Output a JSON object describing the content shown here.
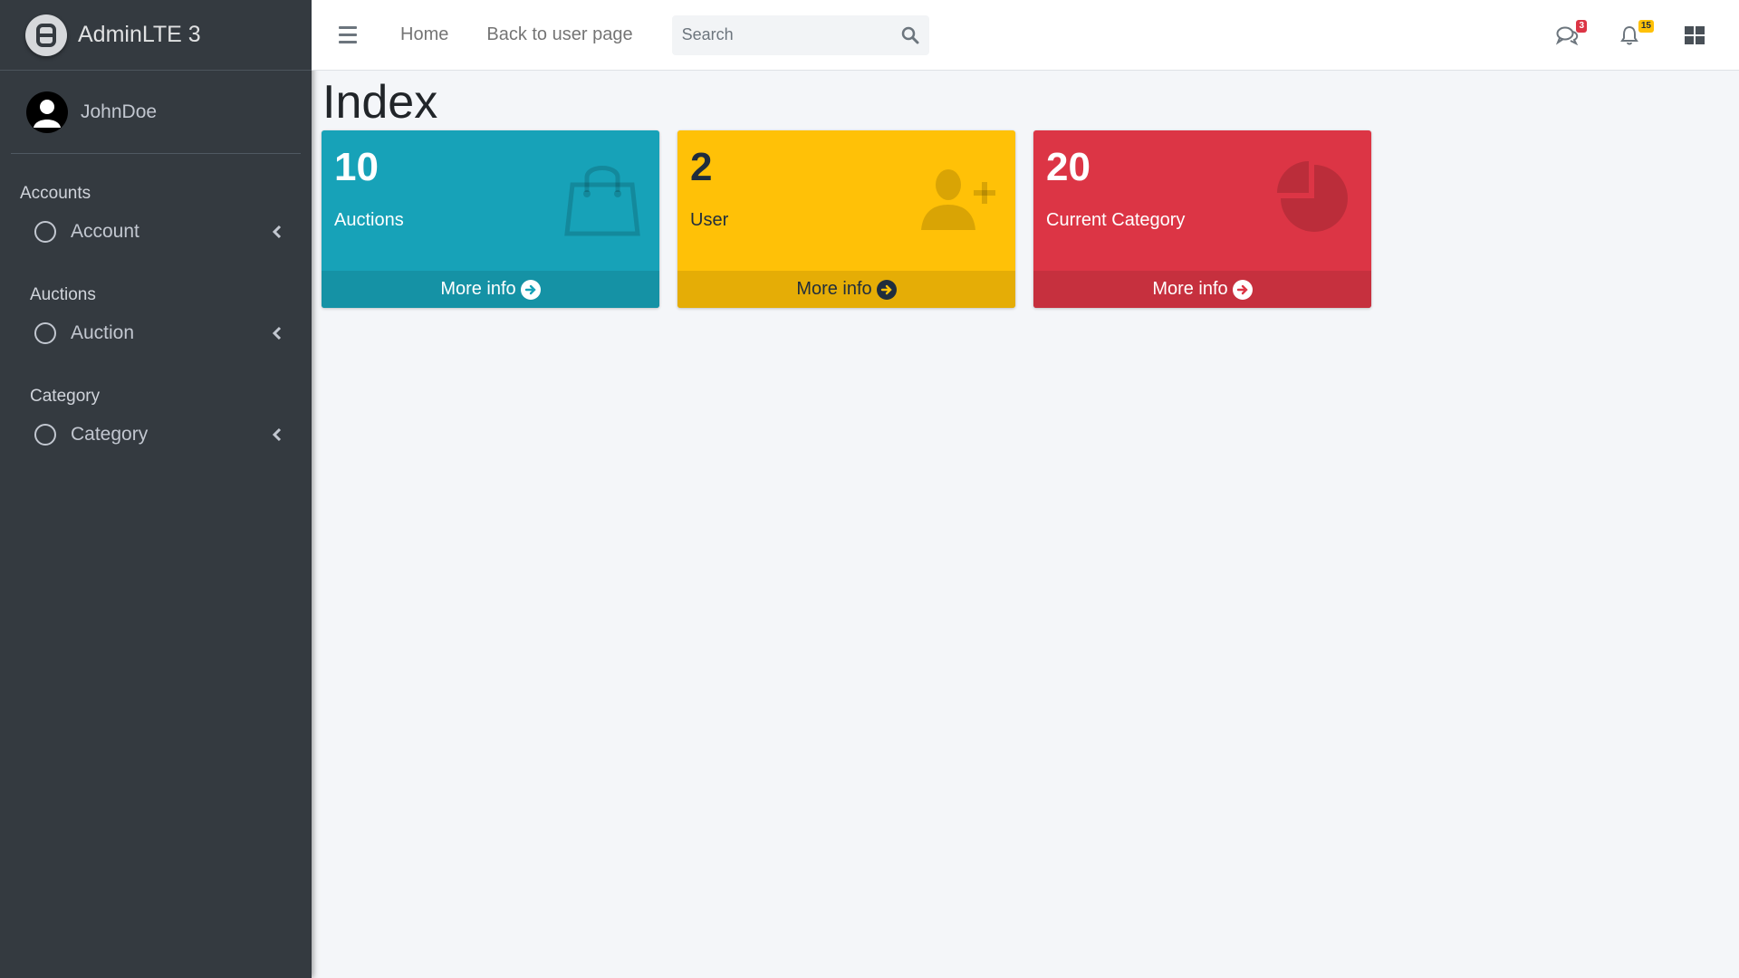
{
  "brand": {
    "name": "AdminLTE 3",
    "logo_icon": "adminlte-logo-icon"
  },
  "user": {
    "name": "JohnDoe",
    "avatar_icon": "user-avatar-icon"
  },
  "sidebar": {
    "sections": [
      {
        "header": "Accounts",
        "item": {
          "label": "Account",
          "icon": "circle-icon"
        }
      },
      {
        "header": "Auctions",
        "item": {
          "label": "Auction",
          "icon": "circle-icon"
        }
      },
      {
        "header": "Category",
        "item": {
          "label": "Category",
          "icon": "circle-icon"
        }
      }
    ]
  },
  "navbar": {
    "links": [
      "Home",
      "Back to user page"
    ],
    "search": {
      "placeholder": "Search",
      "value": ""
    },
    "messages_badge": "3",
    "notifications_badge": "15"
  },
  "page": {
    "title": "Index"
  },
  "cards": [
    {
      "value": "10",
      "label": "Auctions",
      "footer": "More info",
      "icon": "shopping-bag-icon",
      "color": "#17a2b8"
    },
    {
      "value": "2",
      "label": "User",
      "footer": "More info",
      "icon": "user-plus-icon",
      "color": "#ffc107"
    },
    {
      "value": "20",
      "label": "Current Category",
      "footer": "More info",
      "icon": "pie-chart-icon",
      "color": "#dc3545"
    }
  ]
}
